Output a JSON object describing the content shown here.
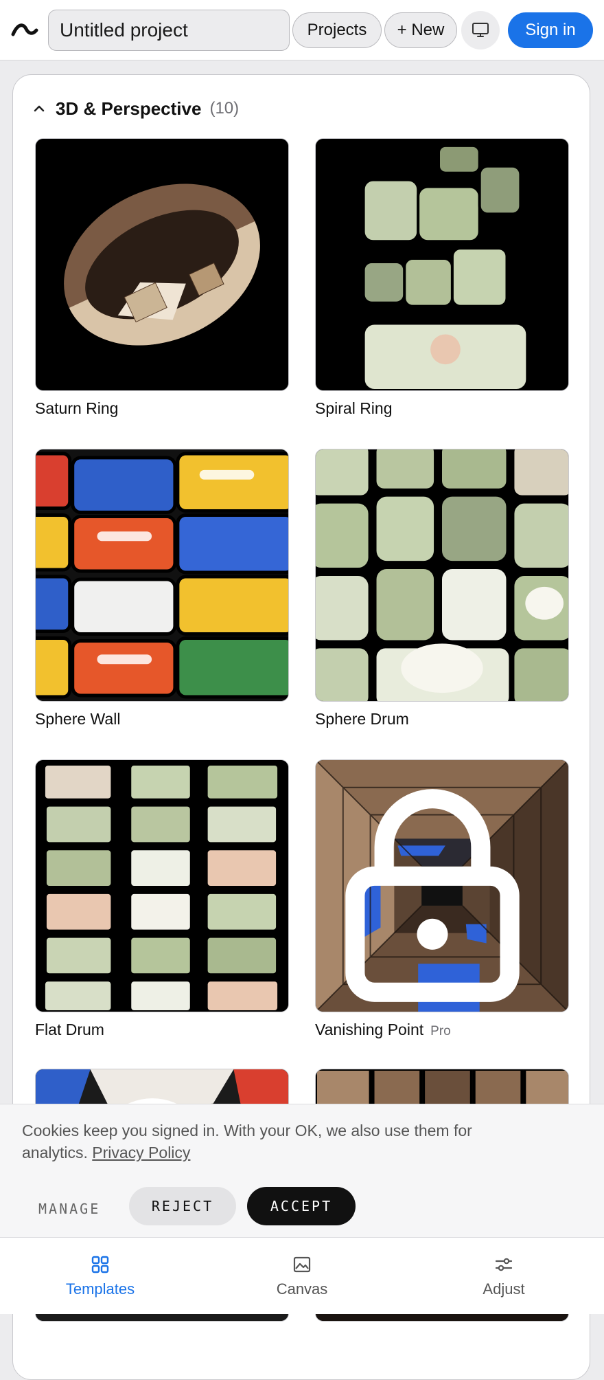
{
  "header": {
    "project_title": "Untitled project",
    "projects_label": "Projects",
    "new_label": "+ New",
    "signin_label": "Sign in",
    "logo_icon": "app-logo-arc-icon",
    "desktop_icon": "monitor-icon"
  },
  "section": {
    "title": "3D & Perspective",
    "count": "(10)",
    "chevron_icon": "chevron-up-icon"
  },
  "templates": [
    {
      "label": "Saturn Ring",
      "pro": ""
    },
    {
      "label": "Spiral Ring",
      "pro": ""
    },
    {
      "label": "Sphere Wall",
      "pro": ""
    },
    {
      "label": "Sphere Drum",
      "pro": ""
    },
    {
      "label": "Flat Drum",
      "pro": ""
    },
    {
      "label": "Vanishing Point",
      "pro": "Pro"
    }
  ],
  "cookie": {
    "text": "Cookies keep you signed in. With your OK, we also use them for analytics.",
    "privacy_link": "Privacy Policy",
    "manage_label": "MANAGE",
    "reject_label": "REJECT",
    "accept_label": "ACCEPT"
  },
  "bottom_nav": {
    "templates_label": "Templates",
    "canvas_label": "Canvas",
    "adjust_label": "Adjust"
  },
  "colors": {
    "accent": "#1a73e8",
    "background": "#ececee",
    "dark_button": "#111111"
  }
}
